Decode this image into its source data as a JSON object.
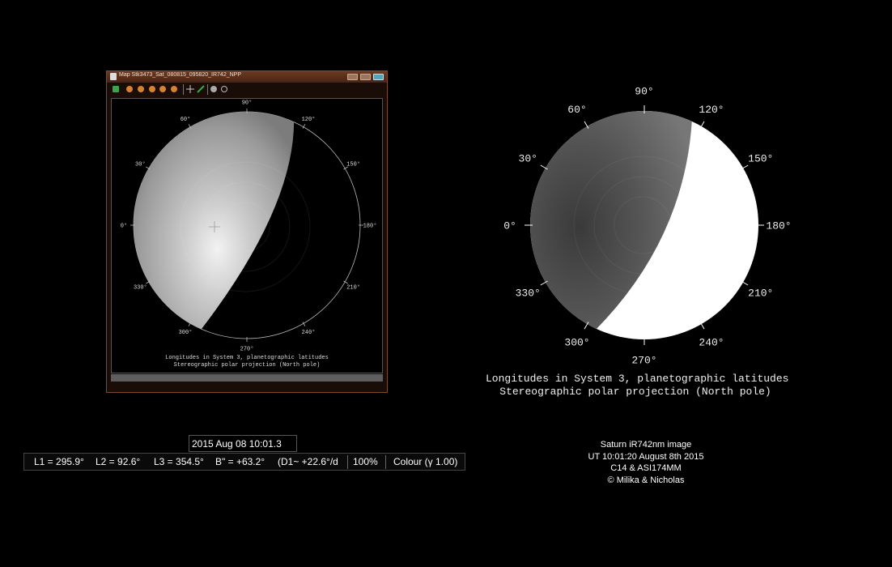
{
  "map_window": {
    "title": "Map  Stk3473_Sat_080815_095820_IR742_NPP",
    "icon": "map-window-icon",
    "controls": [
      "minimize-icon",
      "restore-icon",
      "close-icon"
    ],
    "toolbar_icons": [
      "save-icon",
      "zoom-out-icon",
      "rewind-icon",
      "back-icon",
      "forward-icon",
      "fast-forward-icon",
      "crosshair-icon",
      "resize-icon",
      "fill-circle-icon",
      "empty-circle-icon"
    ],
    "ticks": [
      "90°",
      "120°",
      "150°",
      "180°",
      "210°",
      "240°",
      "270°",
      "300°",
      "330°",
      "0°",
      "30°",
      "60°"
    ],
    "caption_line1": "Longitudes in System 3, planetographic latitudes",
    "caption_line2": "Stereographic polar projection (North pole)"
  },
  "big_map": {
    "ticks": [
      "90°",
      "120°",
      "150°",
      "180°",
      "210°",
      "240°",
      "270°",
      "300°",
      "330°",
      "0°",
      "30°",
      "60°"
    ],
    "caption_line1": "Longitudes in System 3, planetographic latitudes",
    "caption_line2": "Stereographic polar projection (North pole)"
  },
  "info": {
    "date": "2015 Aug 08  10:01.3",
    "l1": "L1 = 295.9°",
    "l2": "L2 =  92.6°",
    "l3": "L3 = 354.5°",
    "b": "B\" = +63.2°",
    "d1": "(D1~ +22.6°/d",
    "zoom": "100%",
    "colour": "Colour (γ 1.00)"
  },
  "credits": {
    "line1": "Saturn iR742nm image",
    "line2": "UT 10:01:20 August 8th 2015",
    "line3": "C14 & ASI174MM",
    "line4": "© Milika & Nicholas"
  }
}
